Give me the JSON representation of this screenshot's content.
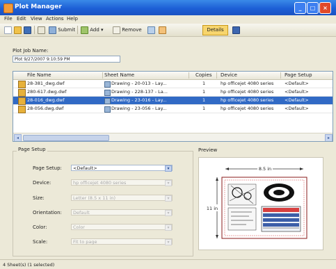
{
  "window": {
    "title": "Plot Manager",
    "controls": {
      "minimize": "_",
      "maximize": "□",
      "close": "×"
    }
  },
  "menubar": [
    "File",
    "Edit",
    "View",
    "Actions",
    "Help"
  ],
  "toolbar": {
    "submit": "Submit",
    "add": "Add",
    "remove": "Remove",
    "details": "Details"
  },
  "job": {
    "label": "Plot Job Name:",
    "value": "Plot 9/27/2007 9:10:59 PM"
  },
  "table": {
    "columns": [
      "File Name",
      "Sheet Name",
      "Copies",
      "Device",
      "Page Setup"
    ],
    "rows": [
      {
        "file": "28-381_dwg.dwf",
        "sheet": "Drawing - 20-013 - Lay...",
        "copies": "1",
        "device": "hp officejet 4080 series",
        "setup": "<Default>",
        "selected": false
      },
      {
        "file": "280-617.dwg.dwf",
        "sheet": "Drawing - 228-137 - La...",
        "copies": "1",
        "device": "hp officejet 4080 series",
        "setup": "<Default>",
        "selected": false
      },
      {
        "file": "28-016_dwg.dwf",
        "sheet": "Drawing - 23-016 - Lay...",
        "copies": "1",
        "device": "hp officejet 4080 series",
        "setup": "<Default>",
        "selected": true
      },
      {
        "file": "28-056.dwg.dwf",
        "sheet": "Drawing - 23-056 - Lay...",
        "copies": "1",
        "device": "hp officejet 4080 series",
        "setup": "<Default>",
        "selected": false
      }
    ],
    "hscroll": {
      "left": "◂",
      "right": "▸"
    }
  },
  "page_setup": {
    "title": "Page Setup",
    "fields": [
      {
        "label": "Page Setup:",
        "value": "<Default>",
        "enabled": true
      },
      {
        "label": "Device:",
        "value": "hp officejet 4080 series",
        "enabled": false
      },
      {
        "label": "Size:",
        "value": "Letter (8.5 x 11 in)",
        "enabled": false
      },
      {
        "label": "Orientation:",
        "value": "Default",
        "enabled": false
      },
      {
        "label": "Color:",
        "value": "Color",
        "enabled": false
      },
      {
        "label": "Scale:",
        "value": "Fit to page",
        "enabled": false
      }
    ]
  },
  "preview": {
    "title": "Preview",
    "width_label": "8.5 in",
    "height_label": "11 in"
  },
  "status": {
    "text": "4 Sheet(s) (1 selected)"
  }
}
